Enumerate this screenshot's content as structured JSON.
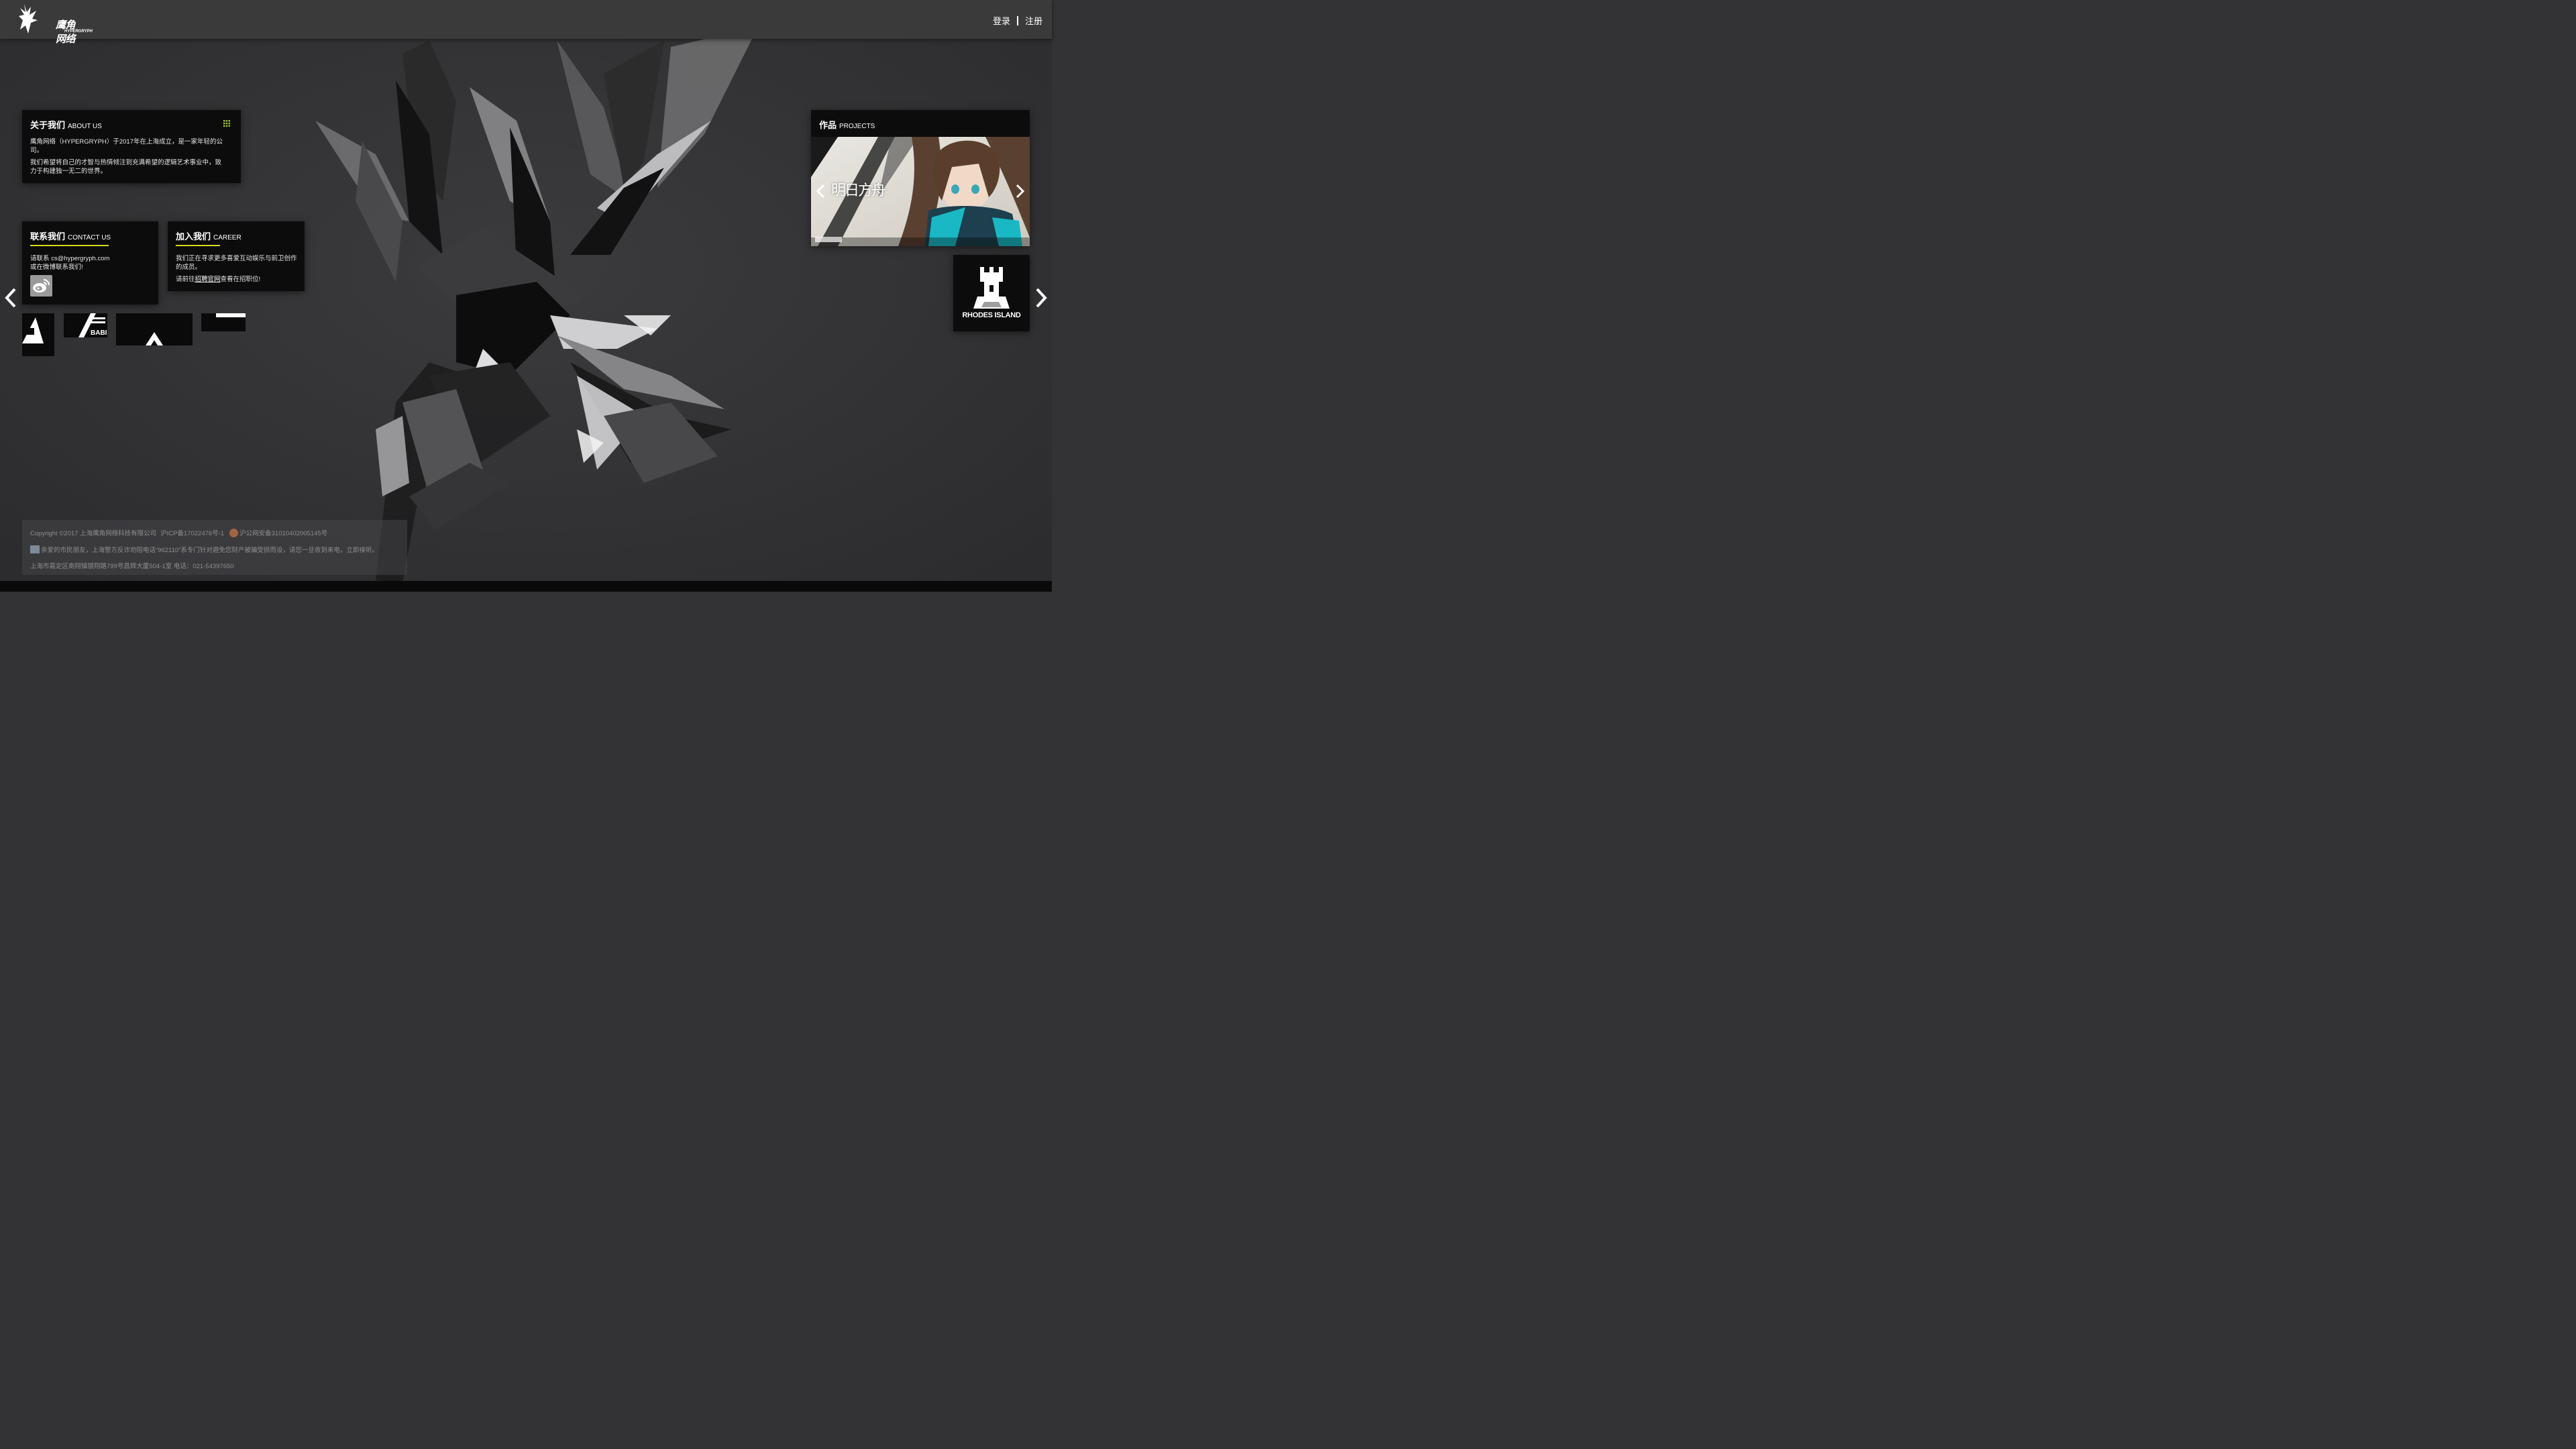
{
  "header": {
    "logo_text": "鹰角网络",
    "logo_sub": "HYPERGRYPH",
    "login_label": "登录",
    "register_label": "注册"
  },
  "about": {
    "title": "关于我们",
    "title_en": "ABOUT US",
    "p1": "鹰角网络（HYPERGRYPH）于2017年在上海成立，是一家年轻的公司。",
    "p2": "我们希望将自己的才智与热情倾注到充满希望的逻辑艺术事业中，致力于构建独一无二的世界。"
  },
  "contact": {
    "title": "联系我们",
    "title_en": "CONTACT US",
    "line1": "请联系 cs@hypergryph.com",
    "line2": "或在微博联系我们!",
    "weibo_icon": "weibo-icon"
  },
  "career": {
    "title": "加入我们",
    "title_en": "CAREER",
    "p1": "我们正在寻求更多喜爱互动娱乐与前卫创作的成员。",
    "p2_prefix": "请前往",
    "p2_link": "招聘官网",
    "p2_suffix": "查看在招职位!"
  },
  "projects": {
    "title": "作品",
    "title_en": "PROJECTS",
    "banner_title": "明日方舟",
    "rhodes_label": "RHODES ISLAND"
  },
  "tiles": {
    "tile2_text": "BABI"
  },
  "footer": {
    "copyright": "Copyright ©2017 上海鹰角网络科技有限公司",
    "icp": "沪ICP备17022476号-1",
    "police": "沪公网安备31010402005145号",
    "notice": "亲爱的市民朋友，上海警方反诈劝阻电话“962110”系专门针对避免您财产被骗受损而设，请您一旦收到来电，立即接听。",
    "address": "上海市嘉定区南翔镇银翔路799号昌辉大厦504-1室 电话：021-54397650"
  },
  "colors": {
    "accent": "#d6d61a",
    "background": "#333335",
    "card": "#0c0c0d"
  }
}
